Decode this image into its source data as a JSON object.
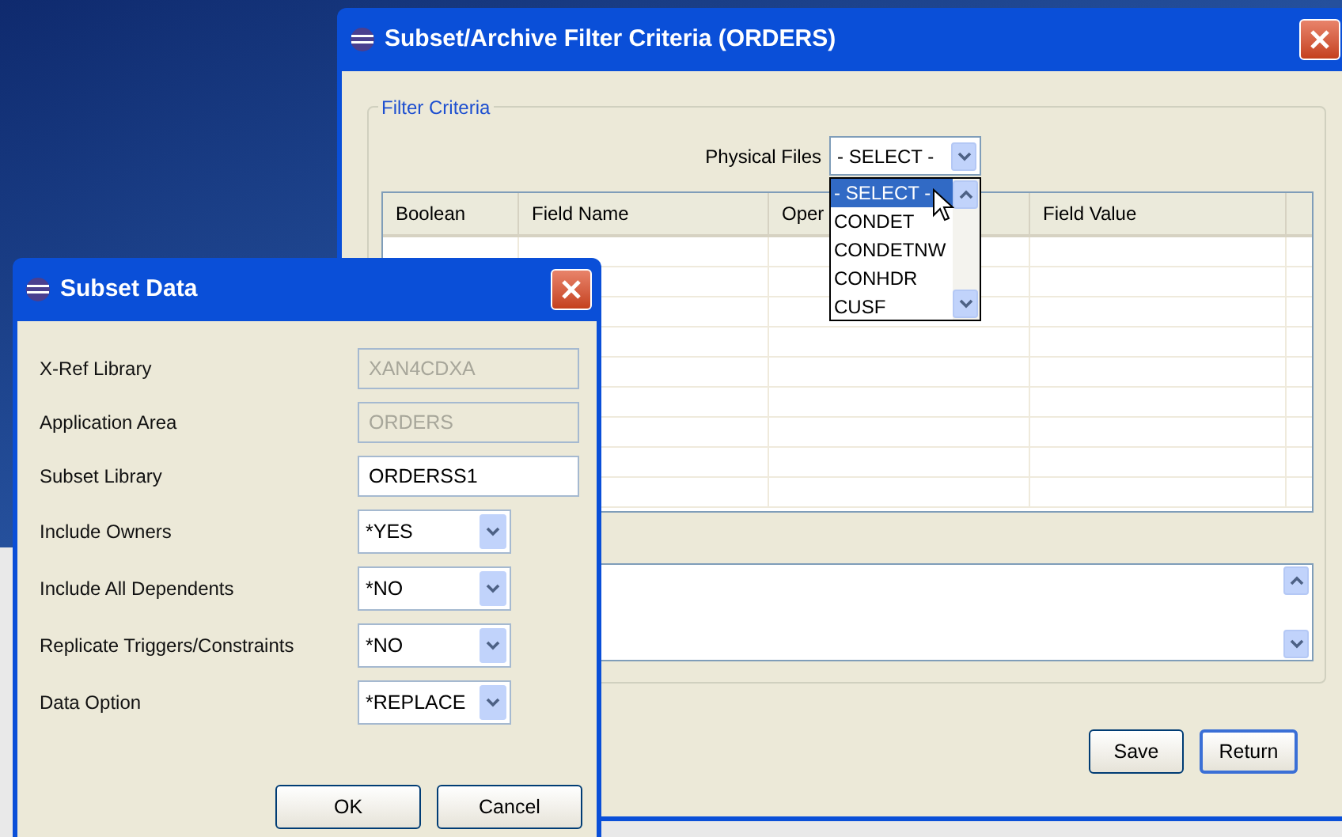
{
  "main_window": {
    "title": "Subset/Archive Filter Criteria (ORDERS)",
    "group_title": "Filter Criteria",
    "physical_files": {
      "label": "Physical Files",
      "value": "- SELECT -",
      "expanded": true,
      "options": [
        {
          "label": "- SELECT -",
          "selected": true
        },
        {
          "label": "CONDET",
          "selected": false
        },
        {
          "label": "CONDETNW",
          "selected": false
        },
        {
          "label": "CONHDR",
          "selected": false
        },
        {
          "label": "CUSF",
          "selected": false
        }
      ]
    },
    "table": {
      "columns": [
        "Boolean",
        "Field Name",
        "Oper",
        "Field Value"
      ]
    },
    "buttons": [
      "Save",
      "Return"
    ]
  },
  "subset_dialog": {
    "title": "Subset Data",
    "fields": [
      {
        "label": "X-Ref Library",
        "value": "XAN4CDXA",
        "kind": "text",
        "disabled": true
      },
      {
        "label": "Application Area",
        "value": "ORDERS",
        "kind": "text",
        "disabled": true
      },
      {
        "label": "Subset Library",
        "value": "ORDERSS1",
        "kind": "text",
        "disabled": false
      },
      {
        "label": "Include Owners",
        "value": "*YES",
        "kind": "dropdown"
      },
      {
        "label": "Include All Dependents",
        "value": "*NO",
        "kind": "dropdown"
      },
      {
        "label": "Replicate Triggers/Constraints",
        "value": "*NO",
        "kind": "dropdown"
      },
      {
        "label": "Data Option",
        "value": "*REPLACE",
        "kind": "dropdown"
      }
    ],
    "buttons": [
      "OK",
      "Cancel"
    ]
  }
}
